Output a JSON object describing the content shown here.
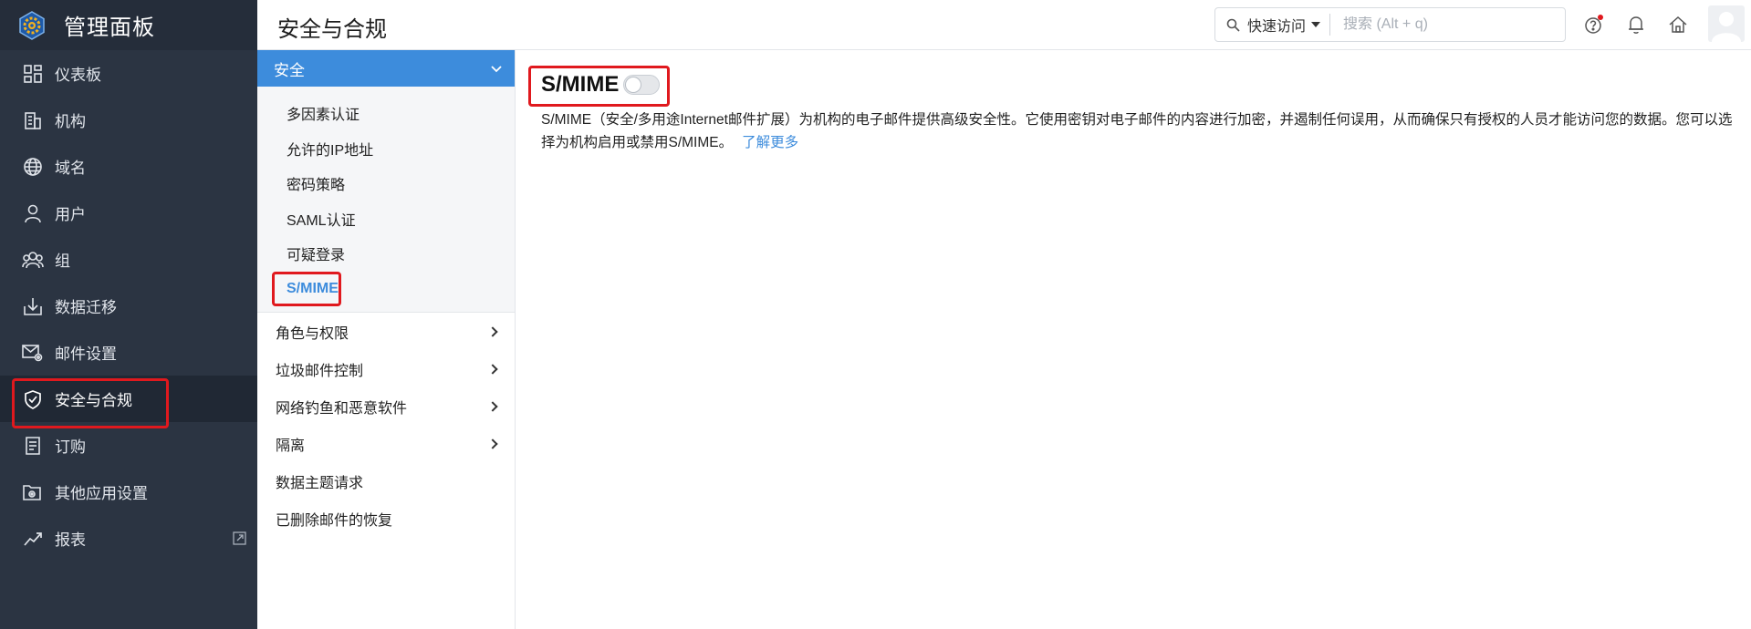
{
  "app": {
    "title": "管理面板"
  },
  "sidebar": {
    "items": [
      {
        "label": "仪表板",
        "icon": "dashboard-icon"
      },
      {
        "label": "机构",
        "icon": "building-icon"
      },
      {
        "label": "域名",
        "icon": "globe-icon"
      },
      {
        "label": "用户",
        "icon": "user-icon"
      },
      {
        "label": "组",
        "icon": "group-icon"
      },
      {
        "label": "数据迁移",
        "icon": "migration-icon"
      },
      {
        "label": "邮件设置",
        "icon": "mail-settings-icon"
      },
      {
        "label": "安全与合规",
        "icon": "shield-check-icon",
        "active": true
      },
      {
        "label": "订购",
        "icon": "receipt-icon"
      },
      {
        "label": "其他应用设置",
        "icon": "apps-settings-icon"
      },
      {
        "label": "报表",
        "icon": "trend-icon"
      }
    ]
  },
  "header": {
    "title": "安全与合规",
    "quick_access": "快速访问",
    "search_placeholder": "搜索 (Alt + q)"
  },
  "submenu": {
    "section_title": "安全",
    "section_items": [
      {
        "label": "多因素认证"
      },
      {
        "label": "允许的IP地址"
      },
      {
        "label": "密码策略"
      },
      {
        "label": "SAML认证"
      },
      {
        "label": "可疑登录"
      },
      {
        "label": "S/MIME",
        "active": true
      }
    ],
    "groups": [
      {
        "label": "角色与权限",
        "has_children": true
      },
      {
        "label": "垃圾邮件控制",
        "has_children": true
      },
      {
        "label": "网络钓鱼和恶意软件",
        "has_children": true
      },
      {
        "label": "隔离",
        "has_children": true
      },
      {
        "label": "数据主题请求",
        "has_children": false
      },
      {
        "label": "已删除邮件的恢复",
        "has_children": false
      }
    ]
  },
  "main": {
    "title": "S/MIME",
    "toggle_enabled": false,
    "description": "S/MIME（安全/多用途Internet邮件扩展）为机构的电子邮件提供高级安全性。它使用密钥对电子邮件的内容进行加密，并遏制任何误用，从而确保只有授权的人员才能访问您的数据。您可以选择为机构启用或禁用S/MIME。",
    "learn_more": "了解更多"
  },
  "colors": {
    "sidebar_bg": "#2b3442",
    "accent_blue": "#3d8cdc",
    "highlight_red": "#e0191e",
    "notification_dot": "#e0191e"
  }
}
